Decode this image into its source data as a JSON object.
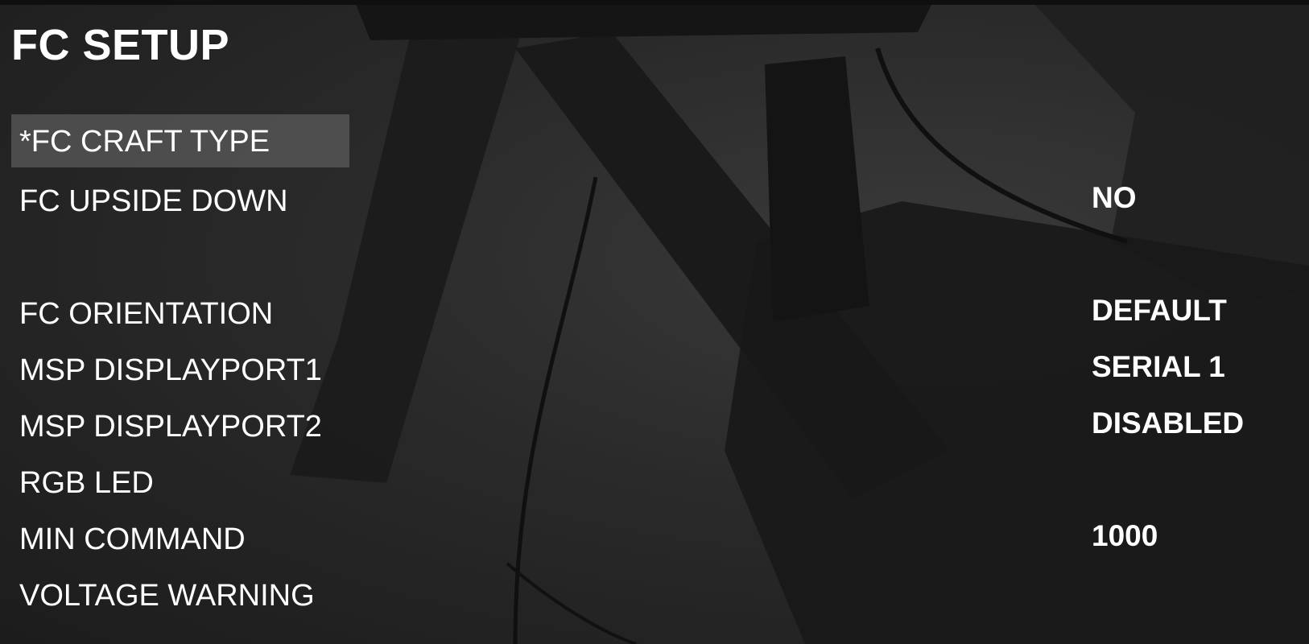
{
  "menu": {
    "title": "FC SETUP",
    "items": [
      {
        "label": "*FC CRAFT TYPE",
        "value": ""
      },
      {
        "label": "FC UPSIDE DOWN",
        "value": "NO"
      },
      {
        "label": "FC ORIENTATION",
        "value": "DEFAULT"
      },
      {
        "label": "MSP DISPLAYPORT1",
        "value": "SERIAL 1"
      },
      {
        "label": "MSP DISPLAYPORT2",
        "value": "DISABLED"
      },
      {
        "label": "RGB LED",
        "value": ""
      },
      {
        "label": "MIN COMMAND",
        "value": "1000"
      },
      {
        "label": "VOLTAGE WARNING",
        "value": ""
      }
    ],
    "selected_index": 0
  },
  "colors": {
    "text": "#ffffff",
    "selection_highlight": "#5a5a5a",
    "background": "#262626"
  }
}
